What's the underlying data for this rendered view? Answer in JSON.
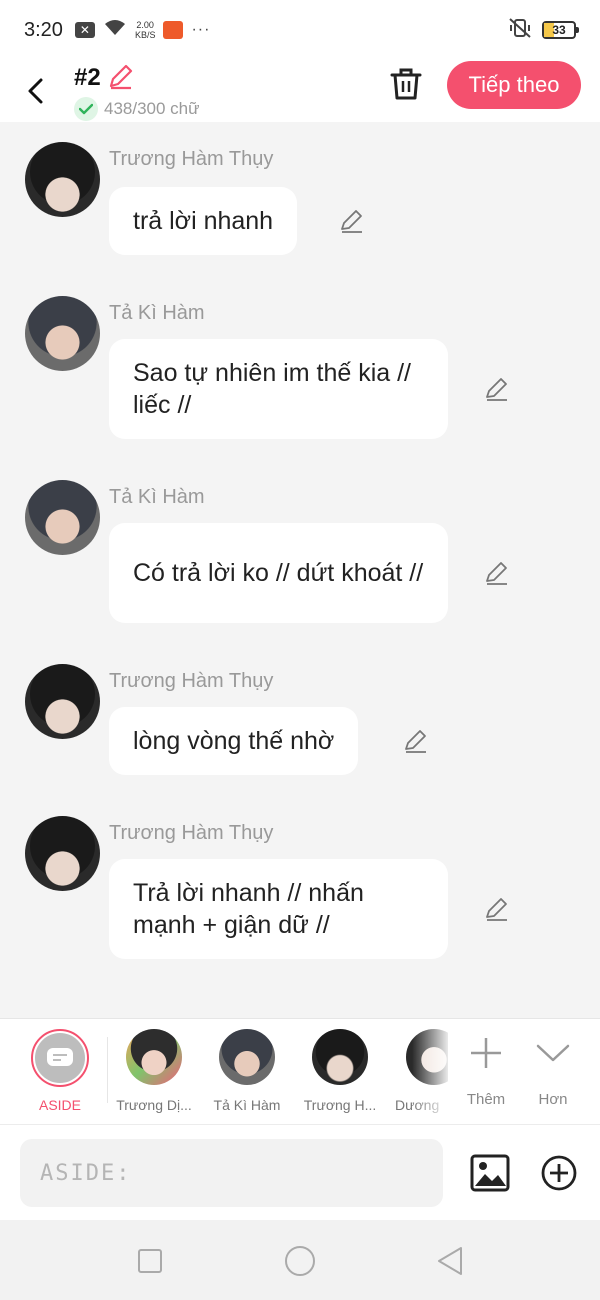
{
  "status_bar": {
    "time": "3:20",
    "speed_value": "2.00",
    "speed_unit": "KB/S",
    "more": "···",
    "battery": "33"
  },
  "header": {
    "title": "#2",
    "word_count": "438/300 chữ",
    "next_label": "Tiếp theo"
  },
  "messages": [
    {
      "sender": "Trương Hàm Thụy",
      "text": "trả lời nhanh",
      "avatar": "dark"
    },
    {
      "sender": "Tả Kì Hàm",
      "text": "Sao tự nhiên im thế kia // liếc //",
      "avatar": "grey"
    },
    {
      "sender": "Tả Kì Hàm",
      "text": "Có trả lời ko // dứt khoát //",
      "avatar": "grey"
    },
    {
      "sender": "Trương Hàm Thụy",
      "text": "lòng vòng thế nhờ",
      "avatar": "dark"
    },
    {
      "sender": "Trương Hàm Thụy",
      "text": "Trả lời nhanh // nhấn mạnh + giận dữ //",
      "avatar": "dark"
    }
  ],
  "characters": {
    "aside_label": "ASIDE",
    "items": [
      {
        "label": "Trương Dị..."
      },
      {
        "label": "Tả Kì Hàm"
      },
      {
        "label": "Trương H..."
      },
      {
        "label": "Dương"
      }
    ],
    "add_label": "Thêm",
    "more_label": "Hơn"
  },
  "input": {
    "placeholder": "ASIDE:"
  },
  "colors": {
    "accent": "#f4506e",
    "background": "#f4f4f4",
    "bubble": "#ffffff"
  }
}
